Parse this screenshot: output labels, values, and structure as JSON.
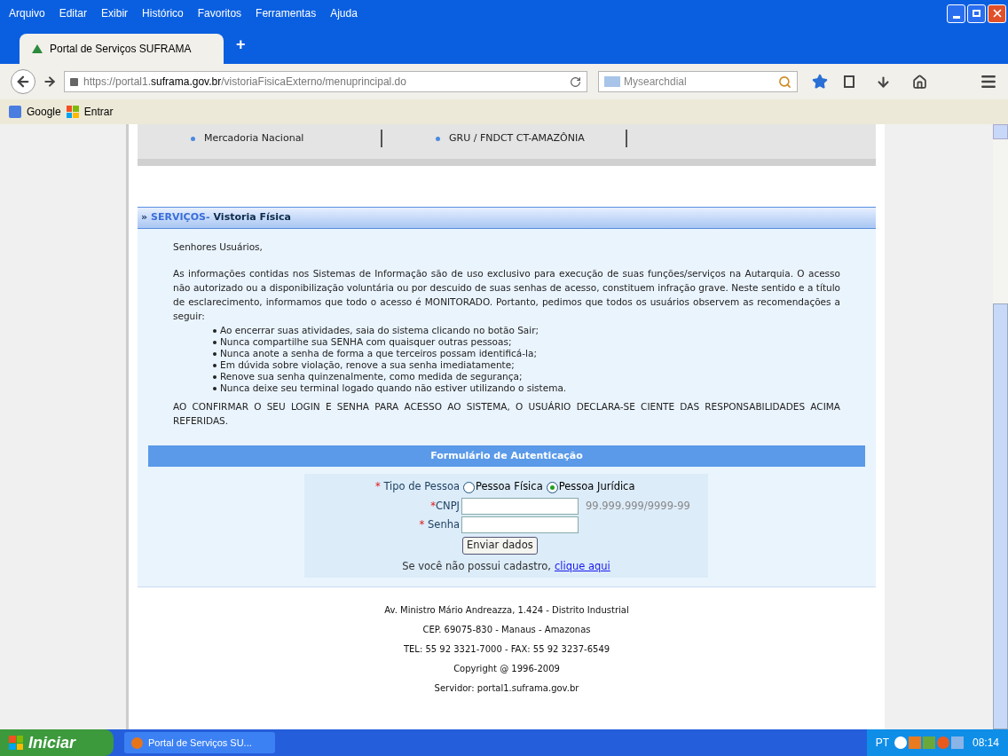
{
  "menu_bar": [
    "Arquivo",
    "Editar",
    "Exibir",
    "Histórico",
    "Favoritos",
    "Ferramentas",
    "Ajuda"
  ],
  "tabs": [
    {
      "label": "Portal de Serviços SUFRAMA",
      "selected": true
    }
  ],
  "new_tab": "+",
  "address": "https://portal1.**suframa.gov.br**/vistoriaFisicaExterno/menuprincipal.do",
  "search": {
    "placeholder": "Mysearchdial"
  },
  "bookmarks": [
    "Google",
    "Entrar"
  ],
  "menu_links": [
    {
      "label": "Mercadoria Nacional"
    },
    {
      "label": "GRU / FNDCT CT-AMAZÔNIA"
    }
  ],
  "section": {
    "prefix": "»",
    "category": "SERVIÇOS-",
    "title": "Vistoria Física"
  },
  "notice": {
    "greeting": "Senhores Usuários,",
    "intro": "As informações contidas nos Sistemas de Informação são de uso exclusivo para execução de suas funções/serviços na Autarquia. O acesso não autorizado ou a disponibilização voluntária ou por descuido de suas senhas de acesso, constituem infração grave. Neste sentido e a título de esclarecimento, informamos que todo o acesso é MONITORADO. Portanto, pedimos que todos os usuários observem as recomendações a seguir:",
    "items": [
      "Ao encerrar suas atividades, saia do sistema clicando no botão Sair;",
      "Nunca compartilhe sua SENHA com quaisquer outras pessoas;",
      "Nunca anote a senha de forma a que terceiros possam identificá-la;",
      "Em dúvida sobre violação, renove a sua senha imediatamente;",
      "Renove sua senha quinzenalmente, como medida de segurança;",
      "Nunca deixe seu terminal logado quando não estiver utilizando o sistema."
    ],
    "closing": "AO CONFIRMAR O SEU LOGIN E SENHA PARA ACESSO AO SISTEMA, O USUÁRIO DECLARA-SE CIENTE DAS RESPONSABILIDADES ACIMA REFERIDAS."
  },
  "form": {
    "title": "Formulário de Autenticação",
    "required_mark": "*",
    "person_label": "Tipo de Pessoa",
    "person_options": [
      {
        "label": "Pessoa Física",
        "selected": false
      },
      {
        "label": "Pessoa Jurídica",
        "selected": true
      }
    ],
    "cnpj_label": "CNPJ",
    "cnpj_hint": "99.999.999/9999-99",
    "password_label": "Senha",
    "submit": "Enviar dados",
    "register_text": "Se você não possui cadastro,",
    "register_link": "clique aqui"
  },
  "footer": [
    "Av. Ministro Mário Andreazza, 1.424 - Distrito Industrial",
    "CEP. 69075-830 - Manaus - Amazonas",
    "TEL: 55 92 3321-7000 - FAX: 55 92 3237-6549",
    "Copyright @ 1996-2009",
    "Servidor: portal1.suframa.gov.br"
  ],
  "taskbar": {
    "start": "Iniciar",
    "window": "Portal de Serviços SU...",
    "language": "PT",
    "clock": "08:14"
  }
}
